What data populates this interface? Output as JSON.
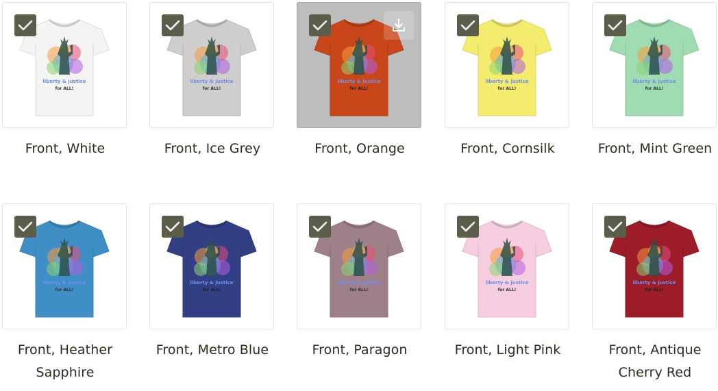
{
  "products": [
    {
      "label": "Front, White",
      "color": "#f4f4f2",
      "selected": true
    },
    {
      "label": "Front, Ice Grey",
      "color": "#cfcecc",
      "selected": true
    },
    {
      "label": "Front, Orange",
      "color": "#c9461a",
      "selected": true
    },
    {
      "label": "Front, Cornsilk",
      "color": "#f4ec6e",
      "selected": true
    },
    {
      "label": "Front, Mint Green",
      "color": "#9fdcb2",
      "selected": true
    },
    {
      "label": "Front, Heather Sapphire",
      "color": "#3f8fc6",
      "selected": true
    },
    {
      "label": "Front, Metro Blue",
      "color": "#323f84",
      "selected": true
    },
    {
      "label": "Front, Paragon",
      "color": "#9e8088",
      "selected": true
    },
    {
      "label": "Front, Light Pink",
      "color": "#f6cee0",
      "selected": true
    },
    {
      "label": "Front, Antique Cherry Red",
      "color": "#9c1c2a",
      "selected": true
    }
  ],
  "print_text": {
    "line1": "liberty & justice",
    "line2": "for ALL!"
  },
  "icons": {
    "select": "checkmark-icon",
    "download": "download-icon"
  },
  "accent": "#5c5c4a"
}
